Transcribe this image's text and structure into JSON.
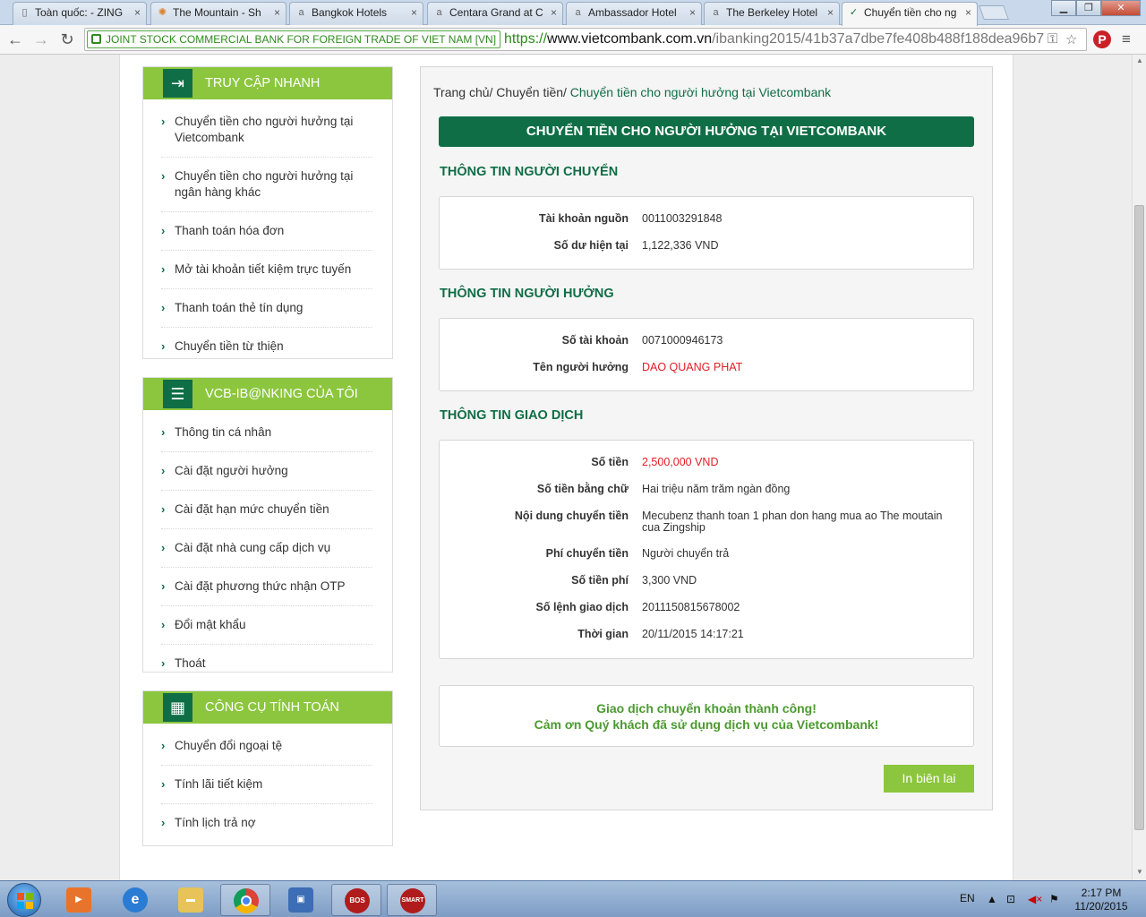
{
  "browser": {
    "tabs": [
      {
        "label": "Toàn quốc: - ZING",
        "icon": "page-icon"
      },
      {
        "label": "The Mountain - Sh",
        "icon": "sun-icon"
      },
      {
        "label": "Bangkok Hotels",
        "icon": "agoda-icon"
      },
      {
        "label": "Centara Grand at C",
        "icon": "agoda-icon"
      },
      {
        "label": "Ambassador Hotel",
        "icon": "agoda-icon"
      },
      {
        "label": "The Berkeley Hotel",
        "icon": "agoda-icon"
      },
      {
        "label": "Chuyển tiền cho ng",
        "icon": "vcb-icon",
        "active": true
      }
    ],
    "ev_label": "JOINT STOCK COMMERCIAL BANK FOR FOREIGN TRADE OF VIET NAM [VN]",
    "url_scheme": "https://",
    "url_host": "www.vietcombank.com.vn",
    "url_path": "/ibanking2015/41b37a7dbe7fe408b488f188dea96b7"
  },
  "sidebar": {
    "quick_access": {
      "title": "TRUY CẬP NHANH",
      "items": [
        "Chuyển tiền cho người hưởng tại Vietcombank",
        "Chuyển tiền cho người hưởng tại ngân hàng khác",
        "Thanh toán hóa đơn",
        "Mở tài khoản tiết kiệm trực tuyến",
        "Thanh toán thẻ tín dụng",
        "Chuyển tiền từ thiện"
      ]
    },
    "my_ibanking": {
      "title": "VCB-IB@NKING CỦA TÔI",
      "items": [
        "Thông tin cá nhân",
        "Cài đặt người hưởng",
        "Cài đặt hạn mức chuyển tiền",
        "Cài đặt nhà cung cấp dịch vụ",
        "Cài đặt phương thức nhận OTP",
        "Đổi mật khẩu",
        "Thoát"
      ]
    },
    "tools": {
      "title": "CÔNG CỤ TÍNH TOÁN",
      "items": [
        "Chuyển đổi ngoại tệ",
        "Tính lãi tiết kiệm",
        "Tính lịch trả nợ"
      ]
    }
  },
  "breadcrumb": {
    "home": "Trang chủ",
    "parent": "Chuyển tiền",
    "current": "Chuyển tiền cho người hưởng tại Vietcombank",
    "separator": "/"
  },
  "page_title": "CHUYỂN TIỀN CHO NGƯỜI HƯỞNG TẠI VIETCOMBANK",
  "sender": {
    "title": "THÔNG TIN NGƯỜI CHUYỂN",
    "rows": [
      {
        "label": "Tài khoản nguồn",
        "value": "0011003291848"
      },
      {
        "label": "Số dư hiện tại",
        "value": "1,122,336 VND"
      }
    ]
  },
  "beneficiary": {
    "title": "THÔNG TIN NGƯỜI HƯỞNG",
    "rows": [
      {
        "label": "Số tài khoản",
        "value": "0071000946173"
      },
      {
        "label": "Tên người hưởng",
        "value": "DAO QUANG PHAT",
        "highlight": true
      }
    ]
  },
  "transaction": {
    "title": "THÔNG TIN GIAO DỊCH",
    "rows": [
      {
        "label": "Số tiền",
        "value": "2,500,000 VND",
        "highlight": true
      },
      {
        "label": "Số tiền bằng chữ",
        "value": "Hai triệu năm trăm ngàn đồng"
      },
      {
        "label": "Nội dung chuyển tiền",
        "value": "Mecubenz thanh toan 1 phan don hang mua ao The moutain cua Zingship"
      },
      {
        "label": "Phí chuyển tiền",
        "value": "Người chuyển trả"
      },
      {
        "label": "Số tiền phí",
        "value": "3,300 VND"
      },
      {
        "label": "Số lệnh giao dịch",
        "value": "2011150815678002"
      },
      {
        "label": "Thời gian",
        "value": "20/11/2015 14:17:21"
      }
    ]
  },
  "success": {
    "line1": "Giao dịch chuyển khoản thành công!",
    "line2": "Cảm ơn Quý khách đã sử dụng dịch vụ của Vietcombank!"
  },
  "print_button": "In biên lai",
  "taskbar": {
    "lang": "EN",
    "time": "2:17 PM",
    "date": "11/20/2015",
    "apps": [
      {
        "name": "media-player-icon",
        "text": ""
      },
      {
        "name": "internet-explorer-icon",
        "text": ""
      },
      {
        "name": "file-explorer-icon",
        "text": ""
      },
      {
        "name": "chrome-icon",
        "text": ""
      },
      {
        "name": "remote-desktop-icon",
        "text": ""
      },
      {
        "name": "bos-icon",
        "text": "BOS"
      },
      {
        "name": "smart-icon",
        "text": "SMART"
      }
    ]
  },
  "colors": {
    "brand_green": "#0f6e46",
    "accent_green": "#8cc63e",
    "highlight_red": "#e51c23"
  }
}
